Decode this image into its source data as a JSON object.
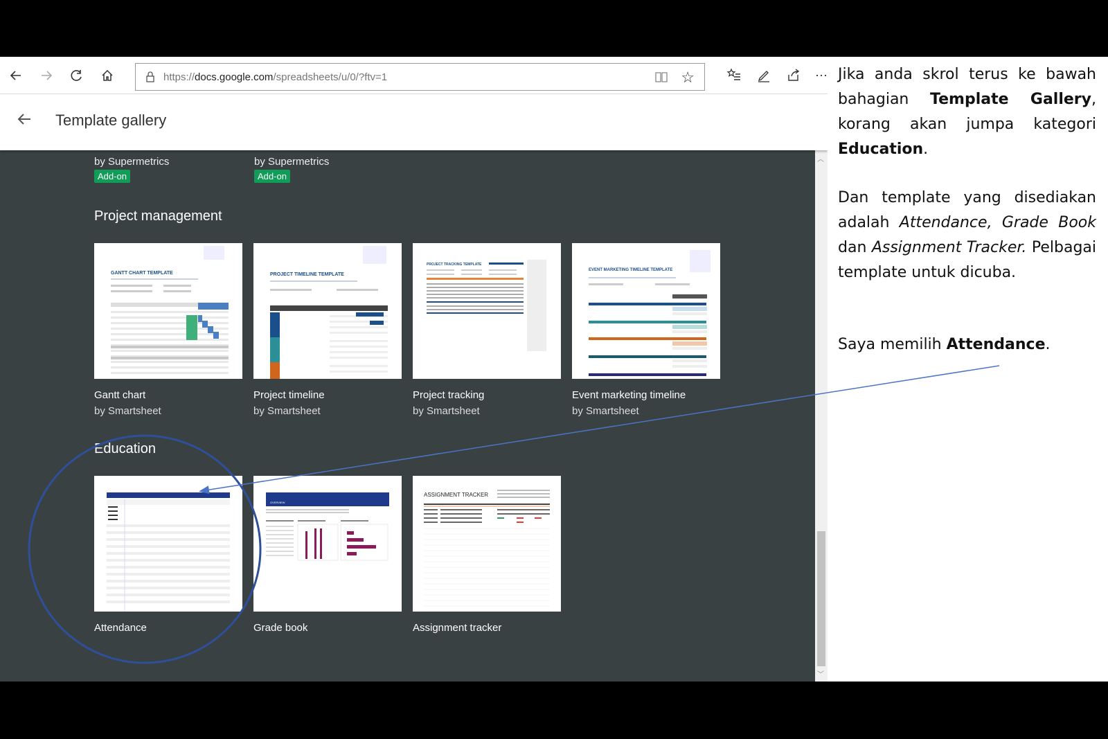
{
  "browser": {
    "url_prefix": "https://",
    "url_host": "docs.google.com",
    "url_path": "/spreadsheets/u/0/?ftv=1",
    "more_label": "⋯"
  },
  "gallery": {
    "title": "Template gallery",
    "top_items": [
      {
        "by": "by Supermetrics",
        "badge": "Add-on"
      },
      {
        "by": "by Supermetrics",
        "badge": "Add-on"
      }
    ],
    "sections": [
      {
        "title": "Project management",
        "cards": [
          {
            "name": "Gantt chart",
            "by": "by Smartsheet",
            "thumb_title": "GANTT CHART TEMPLATE"
          },
          {
            "name": "Project timeline",
            "by": "by Smartsheet",
            "thumb_title": "PROJECT TIMELINE TEMPLATE"
          },
          {
            "name": "Project tracking",
            "by": "by Smartsheet",
            "thumb_title": "PROJECT TRACKING TEMPLATE"
          },
          {
            "name": "Event marketing timeline",
            "by": "by Smartsheet",
            "thumb_title": "EVENT MARKETING TIMELINE TEMPLATE"
          }
        ]
      },
      {
        "title": "Education",
        "cards": [
          {
            "name": "Attendance",
            "by": "",
            "thumb_title": ""
          },
          {
            "name": "Grade book",
            "by": "",
            "thumb_title": "OVERVIEW"
          },
          {
            "name": "Assignment tracker",
            "by": "",
            "thumb_title": "ASSIGNMENT TRACKER"
          }
        ]
      }
    ]
  },
  "sidetext": {
    "p1": [
      "Jika anda skrol terus ke bawah bahagian ",
      "Template Gallery",
      ", korang akan jumpa kategori ",
      "Education",
      "."
    ],
    "p2": [
      "Dan template yang disediakan adalah ",
      "Attendance, Grade Book",
      " dan ",
      "Assignment Tracker.",
      " Pelbagai template untuk dicuba."
    ],
    "p3": [
      "Saya memilih ",
      "Attendance",
      "."
    ]
  },
  "colors": {
    "gallery_bg": "#394142",
    "addon_green": "#0f9d58",
    "annotation_blue": "#2f4f9a",
    "arrow_blue": "#4a74c4"
  }
}
